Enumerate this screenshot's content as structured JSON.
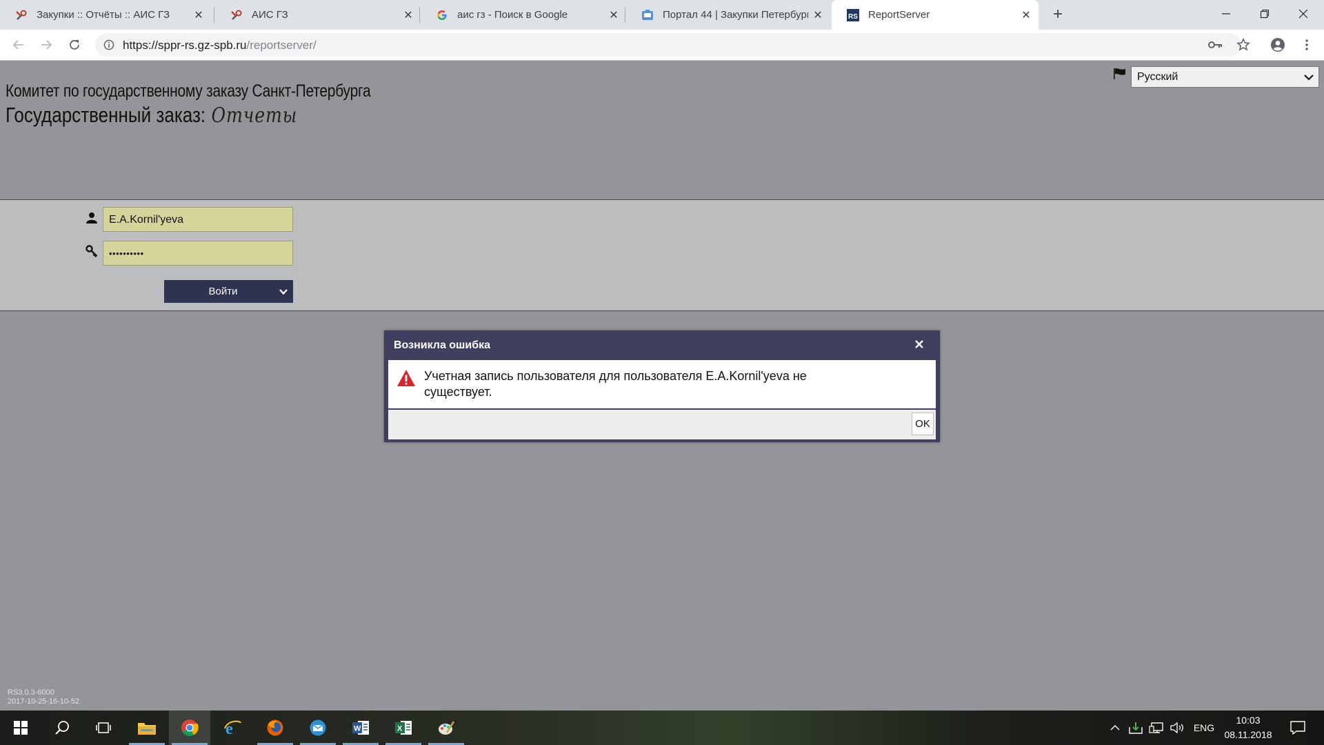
{
  "browser": {
    "tabs": [
      {
        "title": "Закупки :: Отчёты :: АИС ГЗ",
        "icon": "tools-icon",
        "active": false
      },
      {
        "title": "АИС ГЗ",
        "icon": "tools-icon",
        "active": false
      },
      {
        "title": "аис гз - Поиск в Google",
        "icon": "google-icon",
        "active": false
      },
      {
        "title": "Портал 44 | Закупки Петербурга",
        "icon": "portal-icon",
        "active": false
      },
      {
        "title": "ReportServer",
        "icon": "reportserver-icon",
        "active": true
      }
    ],
    "url_host": "https://sppr-rs.gz-spb.ru",
    "url_path": "/reportserver/"
  },
  "header": {
    "org_name": "Комитет по государственному заказу Санкт-Петербурга",
    "product_name": "Государственный заказ:",
    "product_sub": "Отчеты",
    "language": "Русский"
  },
  "login": {
    "username": "E.A.Kornil'yeva",
    "password_mask": "••••••••••",
    "submit_label": "Войти"
  },
  "dialog": {
    "title": "Возникла ошибка",
    "message": "Учетная запись пользователя для пользователя E.A.Kornil'yeva не существует.",
    "ok_label": "OK"
  },
  "footer": {
    "version": "RS3.0.3-6000",
    "build": "2017-10-25-16-10-52"
  },
  "taskbar": {
    "apps": [
      "start-icon",
      "search-icon",
      "task-view-icon",
      "file-explorer-icon",
      "chrome-icon",
      "ie-icon",
      "firefox-icon",
      "mail-icon",
      "word-icon",
      "excel-icon",
      "paint-icon"
    ],
    "language": "ENG",
    "time": "10:03",
    "date": "08.11.2018"
  },
  "colors": {
    "page_bg": "#939598",
    "login_band": "#bcbdbf",
    "input_bg": "#d4d59a",
    "button_bg": "#2f3250",
    "dialog_frame": "#3f4060",
    "warning": "#d9262b"
  }
}
